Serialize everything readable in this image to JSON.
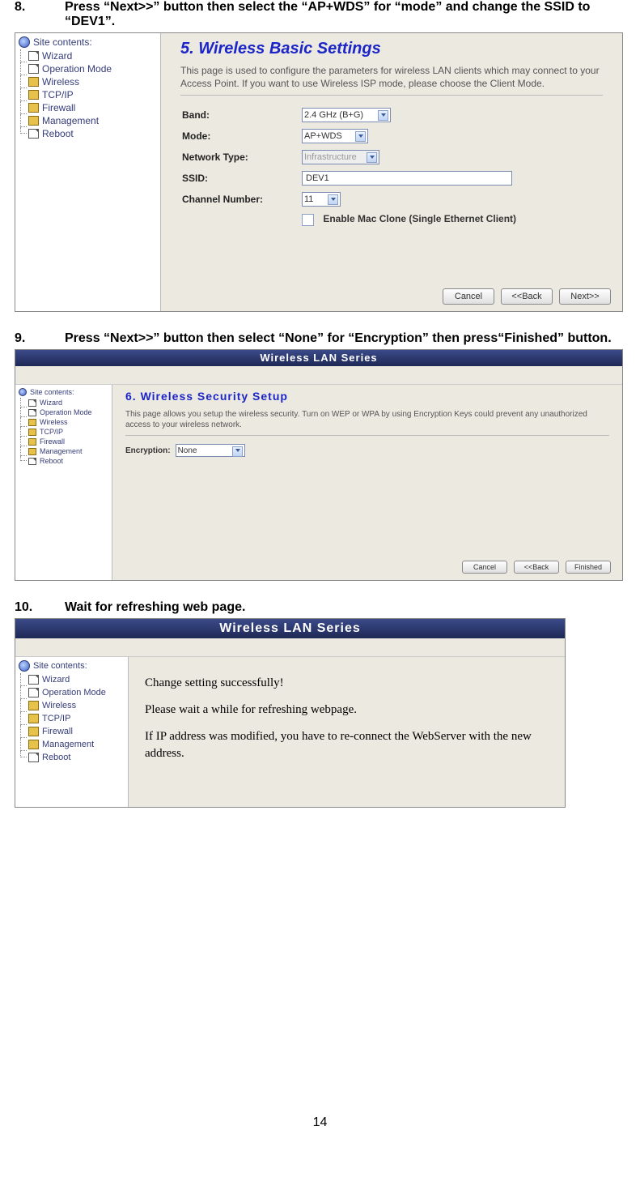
{
  "steps": {
    "s8": {
      "num": "8.",
      "text": "Press “Next>>” button then select the “AP+WDS” for “mode” and change the SSID to “DEV1”."
    },
    "s9": {
      "num": "9.",
      "text": "Press “Next>>” button then select “None” for “Encryption” then press“Finished” button."
    },
    "s10": {
      "num": "10.",
      "text": "Wait for refreshing web page."
    }
  },
  "app_title": "Wireless LAN Series",
  "sidebar": {
    "root": "Site contents:",
    "items": [
      {
        "label": "Wizard",
        "icon": "page"
      },
      {
        "label": "Operation Mode",
        "icon": "page"
      },
      {
        "label": "Wireless",
        "icon": "folder"
      },
      {
        "label": "TCP/IP",
        "icon": "folder"
      },
      {
        "label": "Firewall",
        "icon": "folder"
      },
      {
        "label": "Management",
        "icon": "folder"
      },
      {
        "label": "Reboot",
        "icon": "page"
      }
    ]
  },
  "panel1": {
    "title": "5. Wireless Basic Settings",
    "desc": "This page is used to configure the parameters for wireless LAN clients which may connect to your Access Point. If you want to use Wireless ISP mode, please choose the Client Mode.",
    "fields": {
      "band_label": "Band:",
      "band_value": "2.4 GHz (B+G)",
      "mode_label": "Mode:",
      "mode_value": "AP+WDS",
      "nettype_label": "Network Type:",
      "nettype_value": "Infrastructure",
      "ssid_label": "SSID:",
      "ssid_value": "DEV1",
      "channel_label": "Channel Number:",
      "channel_value": "11",
      "macclone_label": "Enable Mac Clone (Single Ethernet Client)"
    },
    "buttons": {
      "cancel": "Cancel",
      "back": "<<Back",
      "next": "Next>>"
    }
  },
  "panel2": {
    "title": "6. Wireless Security Setup",
    "desc": "This page allows you setup the wireless security. Turn on WEP or WPA by using Encryption Keys could prevent any unauthorized access to your wireless network.",
    "encryption_label": "Encryption:",
    "encryption_value": "None",
    "buttons": {
      "cancel": "Cancel",
      "back": "<<Back",
      "finished": "Finished"
    }
  },
  "panel3": {
    "line1": "Change setting successfully!",
    "line2": "Please wait a while for refreshing webpage.",
    "line3": "If IP address was modified, you have to re-connect the WebServer with the new address."
  },
  "page_number": "14"
}
